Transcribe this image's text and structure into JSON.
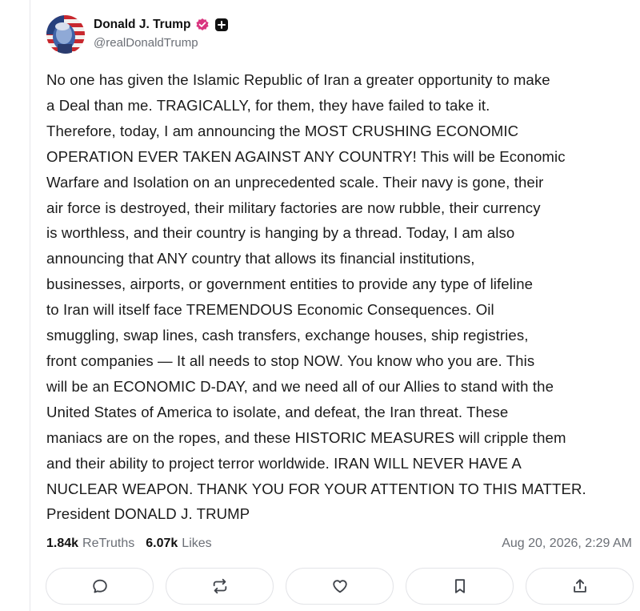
{
  "author": {
    "display_name": "Donald J. Trump",
    "handle": "@realDonaldTrump",
    "verified_badge_icon": "verified-badge-icon",
    "plus_badge_icon": "plus-badge-icon",
    "badge_color": "#d9357f"
  },
  "post": {
    "text": "No one has given the Islamic Republic of Iran a greater opportunity to make\na Deal than me. TRAGICALLY, for them, they have failed to take it.\nTherefore, today, I am announcing the MOST CRUSHING ECONOMIC\nOPERATION EVER TAKEN AGAINST ANY COUNTRY! This will be Economic\nWarfare and Isolation on an unprecedented scale. Their navy is gone, their\nair force is destroyed, their military factories are now rubble, their currency\nis worthless, and their country is hanging by a thread. Today, I am also\nannouncing that ANY country that allows its financial institutions,\nbusinesses, airports, or government entities to provide any type of lifeline\nto Iran will itself face TREMENDOUS Economic Consequences. Oil\nsmuggling, swap lines, cash transfers, exchange houses, ship registries,\nfront companies — It all needs to stop NOW. You know who you are. This\nwill be an ECONOMIC D-DAY, and we need all of our Allies to stand with the\nUnited States of America to isolate, and defeat, the Iran threat. These\nmaniacs are on the ropes, and these HISTORIC MEASURES will cripple them\nand their ability to project terror worldwide. IRAN WILL NEVER HAVE A\nNUCLEAR WEAPON. THANK YOU FOR YOUR ATTENTION TO THIS MATTER.\nPresident DONALD J. TRUMP"
  },
  "stats": {
    "retruths_count": "1.84k",
    "retruths_label": "ReTruths",
    "likes_count": "6.07k",
    "likes_label": "Likes",
    "timestamp": "Aug 20, 2026, 2:29 AM"
  },
  "actions": [
    {
      "icon": "reply-icon"
    },
    {
      "icon": "retruth-icon"
    },
    {
      "icon": "like-icon"
    },
    {
      "icon": "bookmark-icon"
    },
    {
      "icon": "share-icon"
    }
  ]
}
